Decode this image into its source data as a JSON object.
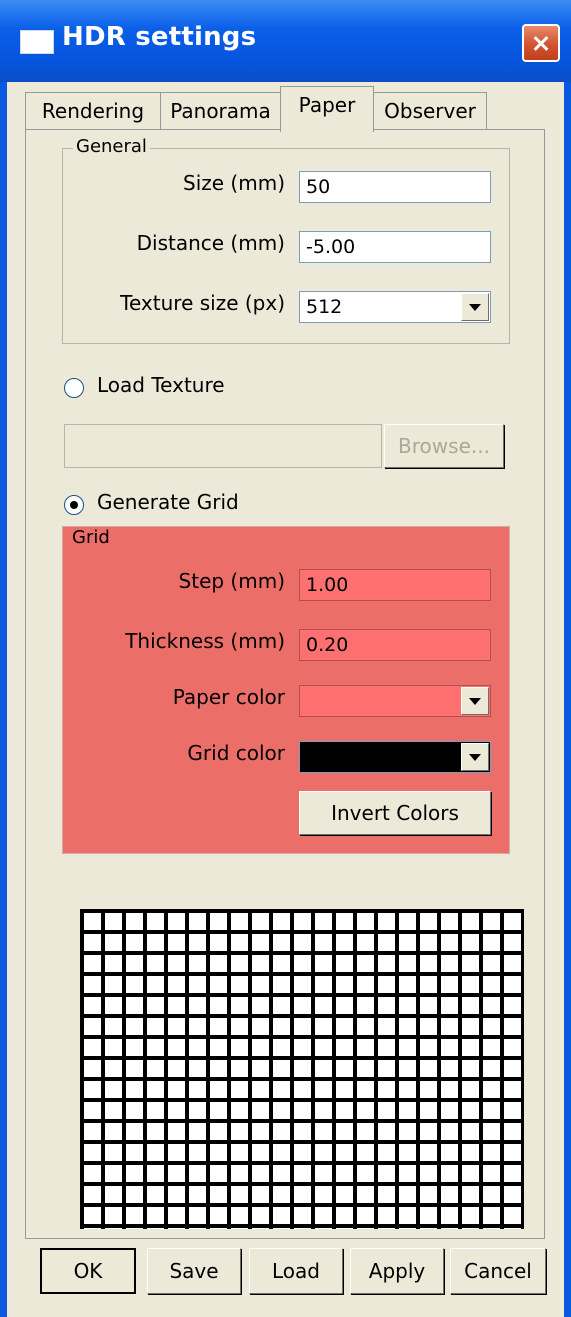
{
  "window": {
    "title": "HDR settings"
  },
  "tabs": [
    {
      "label": "Rendering",
      "active": false
    },
    {
      "label": "Panorama",
      "active": false
    },
    {
      "label": "Paper",
      "active": true
    },
    {
      "label": "Observer",
      "active": false
    }
  ],
  "general": {
    "title": "General",
    "size_label": "Size (mm)",
    "size_value": "50",
    "distance_label": "Distance (mm)",
    "distance_value": "-5.00",
    "texture_label": "Texture size (px)",
    "texture_value": "512"
  },
  "load_texture": {
    "label": "Load Texture",
    "checked": false,
    "path_value": "",
    "browse_label": "Browse..."
  },
  "generate_grid": {
    "label": "Generate Grid",
    "checked": true
  },
  "grid": {
    "title": "Grid",
    "step_label": "Step (mm)",
    "step_value": "1.00",
    "thickness_label": "Thickness (mm)",
    "thickness_value": "0.20",
    "paper_color_label": "Paper color",
    "paper_color": "#ff7070",
    "grid_color_label": "Grid color",
    "grid_color": "#000000",
    "invert_label": "Invert Colors"
  },
  "buttons": {
    "ok": "OK",
    "save": "Save",
    "load": "Load",
    "apply": "Apply",
    "cancel": "Cancel"
  },
  "colors": {
    "titlebar": "#0a58e0",
    "dialog_bg": "#ece9d8",
    "grid_group_bg": "#ec6e68"
  }
}
